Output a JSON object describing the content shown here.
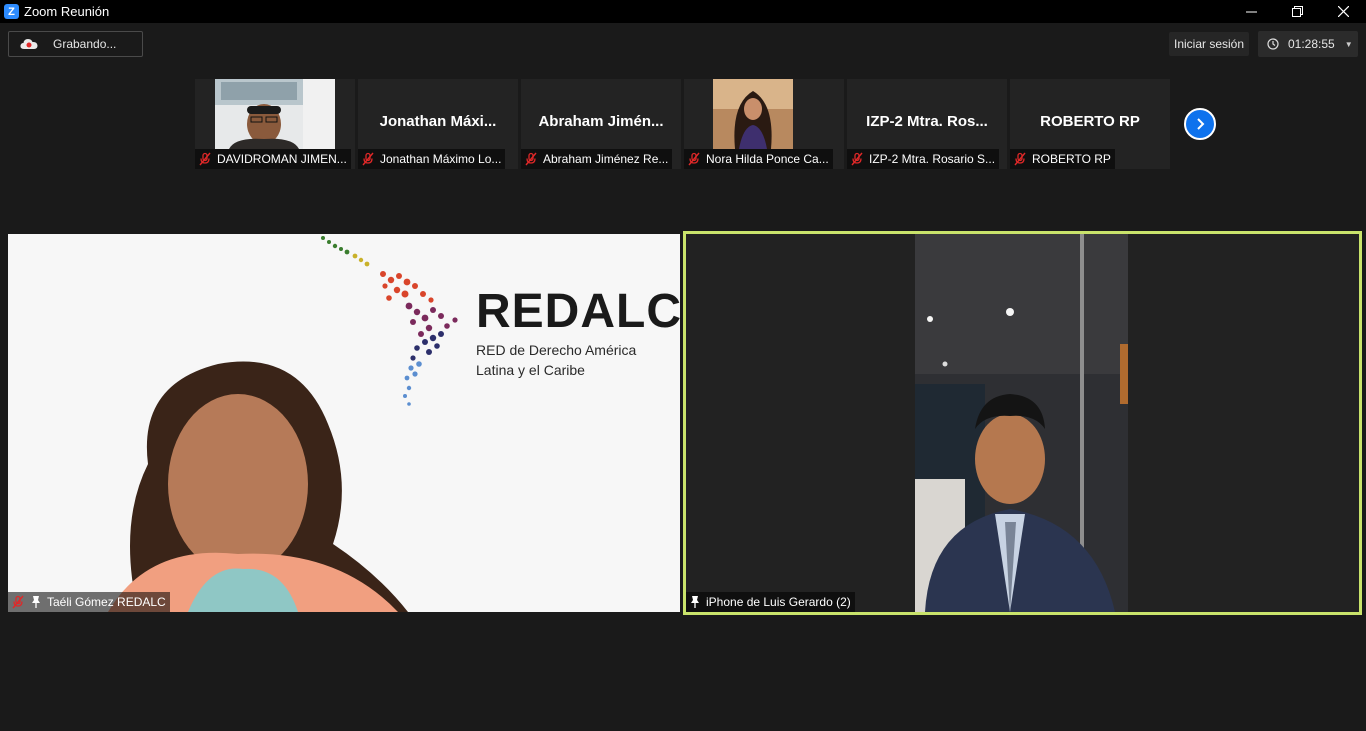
{
  "window": {
    "title": "Zoom Reunión"
  },
  "toolbar": {
    "recording_label": "Grabando...",
    "signin_label": "Iniciar sesión",
    "timer": "01:28:55"
  },
  "thumbnails": [
    {
      "label": "DAVIDROMAN JIMEN...",
      "big_name": ""
    },
    {
      "label": "Jonathan Máximo Lo...",
      "big_name": "Jonathan  Máxi..."
    },
    {
      "label": "Abraham Jiménez Re...",
      "big_name": "Abraham  Jimén..."
    },
    {
      "label": "Nora Hilda Ponce Ca...",
      "big_name": ""
    },
    {
      "label": "IZP-2 Mtra. Rosario S...",
      "big_name": "IZP-2  Mtra. Ros..."
    },
    {
      "label": "ROBERTO RP",
      "big_name": "ROBERTO RP"
    }
  ],
  "main_left": {
    "label": "Taéli Gómez REDALC",
    "logo_title": "REDALC",
    "logo_sub1": "RED de Derecho América",
    "logo_sub2": "Latina y el Caribe"
  },
  "main_right": {
    "label": "iPhone de Luis Gerardo (2)"
  },
  "colors": {
    "accent": "#0e72ed",
    "active_speaker": "#c9e36b",
    "mic_off": "#e02828"
  }
}
